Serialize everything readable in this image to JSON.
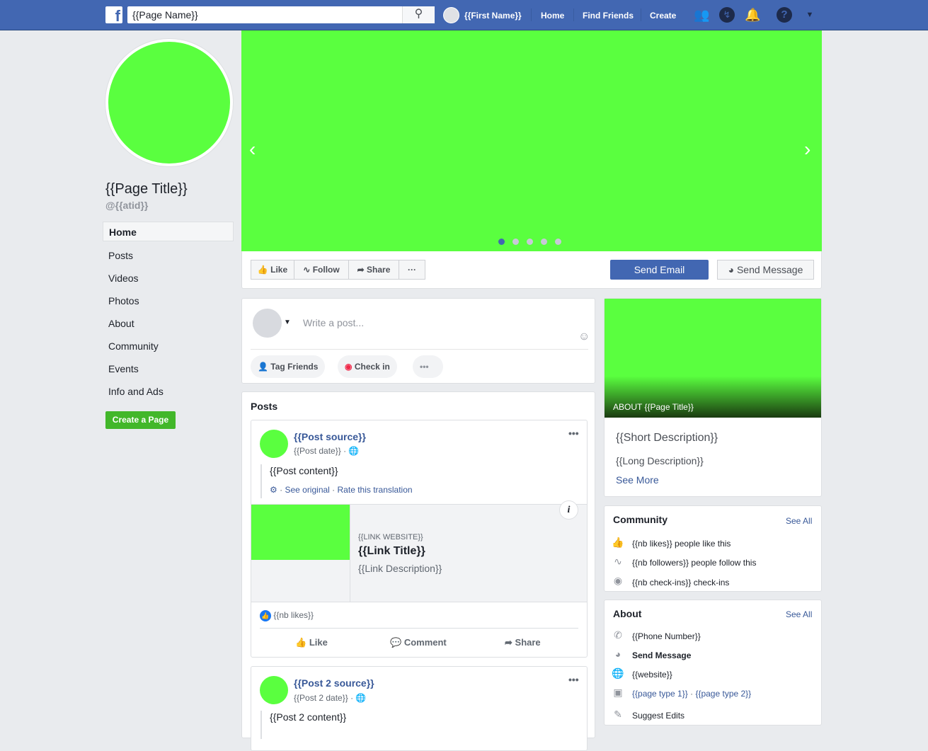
{
  "topbar": {
    "search_value": "{{Page Name}}",
    "user_name": "{{First Name}}",
    "nav": [
      "Home",
      "Find Friends",
      "Create"
    ]
  },
  "sidebar": {
    "page_title": "{{Page Title}}",
    "handle": "@{{atid}}",
    "items": [
      "Home",
      "Posts",
      "Videos",
      "Photos",
      "About",
      "Community",
      "Events",
      "Info and Ads"
    ],
    "active": "Home",
    "create_page": "Create a Page"
  },
  "cover": {
    "slides": 5,
    "active_slide": 1
  },
  "actions": {
    "like": "Like",
    "follow": "Follow",
    "share": "Share",
    "more": "···",
    "send_email": "Send Email",
    "send_message": "Send Message"
  },
  "composer": {
    "placeholder": "Write a post...",
    "tag_friends": "Tag Friends",
    "check_in": "Check in",
    "more": "•••"
  },
  "posts": {
    "heading": "Posts",
    "items": [
      {
        "source": "{{Post source}}",
        "date": "{{Post date}}",
        "content": "{{Post content}}",
        "see_original": "See original",
        "rate": "Rate this translation",
        "link_website": "{{LINK WEBSITE}}",
        "link_title": "{{Link Title}}",
        "link_description": "{{Link Description}}",
        "likes": "{{nb likes}}",
        "like": "Like",
        "comment": "Comment",
        "share": "Share"
      },
      {
        "source": "{{Post 2 source}}",
        "date": "{{Post 2 date}}",
        "content": "{{Post 2 content}}"
      }
    ]
  },
  "about_card": {
    "label": "ABOUT {{Page Title}}",
    "short": "{{Short Description}}",
    "long": "{{Long Description}}",
    "see_more": "See More"
  },
  "community": {
    "title": "Community",
    "see_all": "See All",
    "rows": [
      "{{nb likes}} people like this",
      "{{nb followers}} people follow this",
      "{{nb check-ins}} check-ins"
    ]
  },
  "about": {
    "title": "About",
    "see_all": "See All",
    "phone": "{{Phone Number}}",
    "send_message": "Send Message",
    "website": "{{website}}",
    "page_type_1": "{{page type 1}}",
    "page_type_2": "{{page type 2}}",
    "suggest": "Suggest Edits"
  },
  "colors": {
    "brand": "#4267b2",
    "placeholder_green": "#5aff3f",
    "link": "#385898"
  }
}
